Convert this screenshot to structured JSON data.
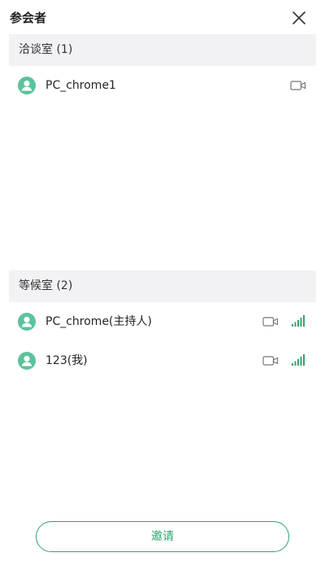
{
  "header": {
    "title": "参会者"
  },
  "meeting_room": {
    "title": "洽谈室 (1)",
    "participants": [
      {
        "name": "PC_chrome1"
      }
    ]
  },
  "waiting_room": {
    "title": "等候室 (2)",
    "participants": [
      {
        "name": "PC_chrome(主持人)"
      },
      {
        "name": "123(我)"
      }
    ]
  },
  "footer": {
    "invite_label": "邀请"
  },
  "icons": {
    "close": "close-icon",
    "avatar": "user-avatar-icon",
    "camera": "video-camera-icon",
    "signal": "signal-strength-icon"
  },
  "colors": {
    "accent": "#29a86b",
    "avatar": "#5cc39b",
    "section_bg": "#f2f2f5"
  }
}
